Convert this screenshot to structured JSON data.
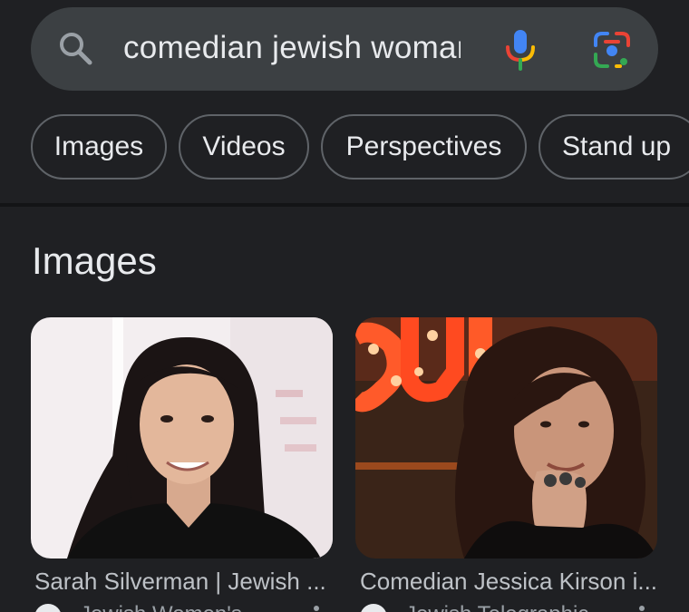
{
  "search": {
    "query": "comedian jewish woman",
    "icons": [
      "search-icon",
      "mic-icon",
      "google-lens-icon"
    ]
  },
  "chips": [
    {
      "label": "Images"
    },
    {
      "label": "Videos"
    },
    {
      "label": "Perspectives"
    },
    {
      "label": "Stand up"
    }
  ],
  "images_section": {
    "title": "Images",
    "results": [
      {
        "caption": "Sarah Silverman | Jewish ...",
        "source": "Jewish Women's ..."
      },
      {
        "caption": "Comedian Jessica Kirson i...",
        "source": "Jewish Telegraphic ..."
      }
    ]
  },
  "colors": {
    "background": "#1f2023",
    "search_bar": "#3c4043",
    "chip_border": "#5f6368",
    "text": "#e8eaed",
    "caption": "#bdc1c6"
  }
}
